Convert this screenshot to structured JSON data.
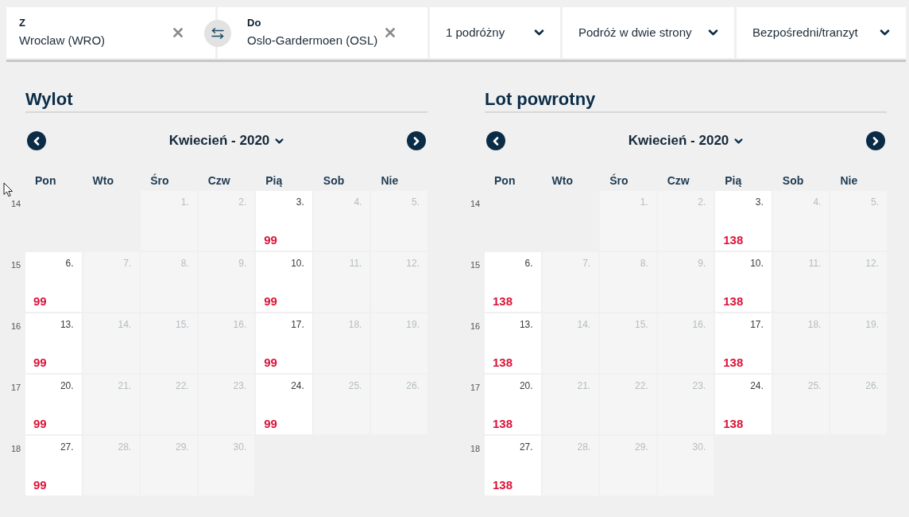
{
  "trip": {
    "from": {
      "label": "Z",
      "value": "Wroclaw (WRO)"
    },
    "to": {
      "label": "Do",
      "value": "Oslo-Gardermoen (OSL)"
    },
    "options": [
      {
        "label": "1 podróżny"
      },
      {
        "label": "Podróż w dwie strony"
      },
      {
        "label": "Bezpośredni/tranzyt"
      }
    ]
  },
  "calendars": [
    {
      "title": "Wylot",
      "month": "Kwiecień - 2020",
      "weekdays": [
        "Pon",
        "Wto",
        "Śro",
        "Czw",
        "Pią",
        "Sob",
        "Nie"
      ],
      "weeks": [
        {
          "number": "14",
          "days": [
            {
              "kind": "blank"
            },
            {
              "kind": "blank"
            },
            {
              "kind": "day",
              "day": "1.",
              "available": false
            },
            {
              "kind": "day",
              "day": "2.",
              "available": false
            },
            {
              "kind": "day",
              "day": "3.",
              "available": true,
              "price": "99"
            },
            {
              "kind": "day",
              "day": "4.",
              "available": false
            },
            {
              "kind": "day",
              "day": "5.",
              "available": false
            }
          ]
        },
        {
          "number": "15",
          "days": [
            {
              "kind": "day",
              "day": "6.",
              "available": true,
              "price": "99"
            },
            {
              "kind": "day",
              "day": "7.",
              "available": false
            },
            {
              "kind": "day",
              "day": "8.",
              "available": false
            },
            {
              "kind": "day",
              "day": "9.",
              "available": false
            },
            {
              "kind": "day",
              "day": "10.",
              "available": true,
              "price": "99"
            },
            {
              "kind": "day",
              "day": "11.",
              "available": false
            },
            {
              "kind": "day",
              "day": "12.",
              "available": false
            }
          ]
        },
        {
          "number": "16",
          "days": [
            {
              "kind": "day",
              "day": "13.",
              "available": true,
              "price": "99"
            },
            {
              "kind": "day",
              "day": "14.",
              "available": false
            },
            {
              "kind": "day",
              "day": "15.",
              "available": false
            },
            {
              "kind": "day",
              "day": "16.",
              "available": false
            },
            {
              "kind": "day",
              "day": "17.",
              "available": true,
              "price": "99"
            },
            {
              "kind": "day",
              "day": "18.",
              "available": false
            },
            {
              "kind": "day",
              "day": "19.",
              "available": false
            }
          ]
        },
        {
          "number": "17",
          "days": [
            {
              "kind": "day",
              "day": "20.",
              "available": true,
              "price": "99"
            },
            {
              "kind": "day",
              "day": "21.",
              "available": false
            },
            {
              "kind": "day",
              "day": "22.",
              "available": false
            },
            {
              "kind": "day",
              "day": "23.",
              "available": false
            },
            {
              "kind": "day",
              "day": "24.",
              "available": true,
              "price": "99"
            },
            {
              "kind": "day",
              "day": "25.",
              "available": false
            },
            {
              "kind": "day",
              "day": "26.",
              "available": false
            }
          ]
        },
        {
          "number": "18",
          "days": [
            {
              "kind": "day",
              "day": "27.",
              "available": true,
              "price": "99"
            },
            {
              "kind": "day",
              "day": "28.",
              "available": false
            },
            {
              "kind": "day",
              "day": "29.",
              "available": false
            },
            {
              "kind": "day",
              "day": "30.",
              "available": false
            }
          ]
        }
      ]
    },
    {
      "title": "Lot powrotny",
      "month": "Kwiecień - 2020",
      "weekdays": [
        "Pon",
        "Wto",
        "Śro",
        "Czw",
        "Pią",
        "Sob",
        "Nie"
      ],
      "weeks": [
        {
          "number": "14",
          "days": [
            {
              "kind": "blank"
            },
            {
              "kind": "blank"
            },
            {
              "kind": "day",
              "day": "1.",
              "available": false
            },
            {
              "kind": "day",
              "day": "2.",
              "available": false
            },
            {
              "kind": "day",
              "day": "3.",
              "available": true,
              "price": "138"
            },
            {
              "kind": "day",
              "day": "4.",
              "available": false
            },
            {
              "kind": "day",
              "day": "5.",
              "available": false
            }
          ]
        },
        {
          "number": "15",
          "days": [
            {
              "kind": "day",
              "day": "6.",
              "available": true,
              "price": "138"
            },
            {
              "kind": "day",
              "day": "7.",
              "available": false
            },
            {
              "kind": "day",
              "day": "8.",
              "available": false
            },
            {
              "kind": "day",
              "day": "9.",
              "available": false
            },
            {
              "kind": "day",
              "day": "10.",
              "available": true,
              "price": "138"
            },
            {
              "kind": "day",
              "day": "11.",
              "available": false
            },
            {
              "kind": "day",
              "day": "12.",
              "available": false
            }
          ]
        },
        {
          "number": "16",
          "days": [
            {
              "kind": "day",
              "day": "13.",
              "available": true,
              "price": "138"
            },
            {
              "kind": "day",
              "day": "14.",
              "available": false
            },
            {
              "kind": "day",
              "day": "15.",
              "available": false
            },
            {
              "kind": "day",
              "day": "16.",
              "available": false
            },
            {
              "kind": "day",
              "day": "17.",
              "available": true,
              "price": "138"
            },
            {
              "kind": "day",
              "day": "18.",
              "available": false
            },
            {
              "kind": "day",
              "day": "19.",
              "available": false
            }
          ]
        },
        {
          "number": "17",
          "days": [
            {
              "kind": "day",
              "day": "20.",
              "available": true,
              "price": "138"
            },
            {
              "kind": "day",
              "day": "21.",
              "available": false
            },
            {
              "kind": "day",
              "day": "22.",
              "available": false
            },
            {
              "kind": "day",
              "day": "23.",
              "available": false
            },
            {
              "kind": "day",
              "day": "24.",
              "available": true,
              "price": "138"
            },
            {
              "kind": "day",
              "day": "25.",
              "available": false
            },
            {
              "kind": "day",
              "day": "26.",
              "available": false
            }
          ]
        },
        {
          "number": "18",
          "days": [
            {
              "kind": "day",
              "day": "27.",
              "available": true,
              "price": "138"
            },
            {
              "kind": "day",
              "day": "28.",
              "available": false
            },
            {
              "kind": "day",
              "day": "29.",
              "available": false
            },
            {
              "kind": "day",
              "day": "30.",
              "available": false
            }
          ]
        }
      ]
    }
  ]
}
